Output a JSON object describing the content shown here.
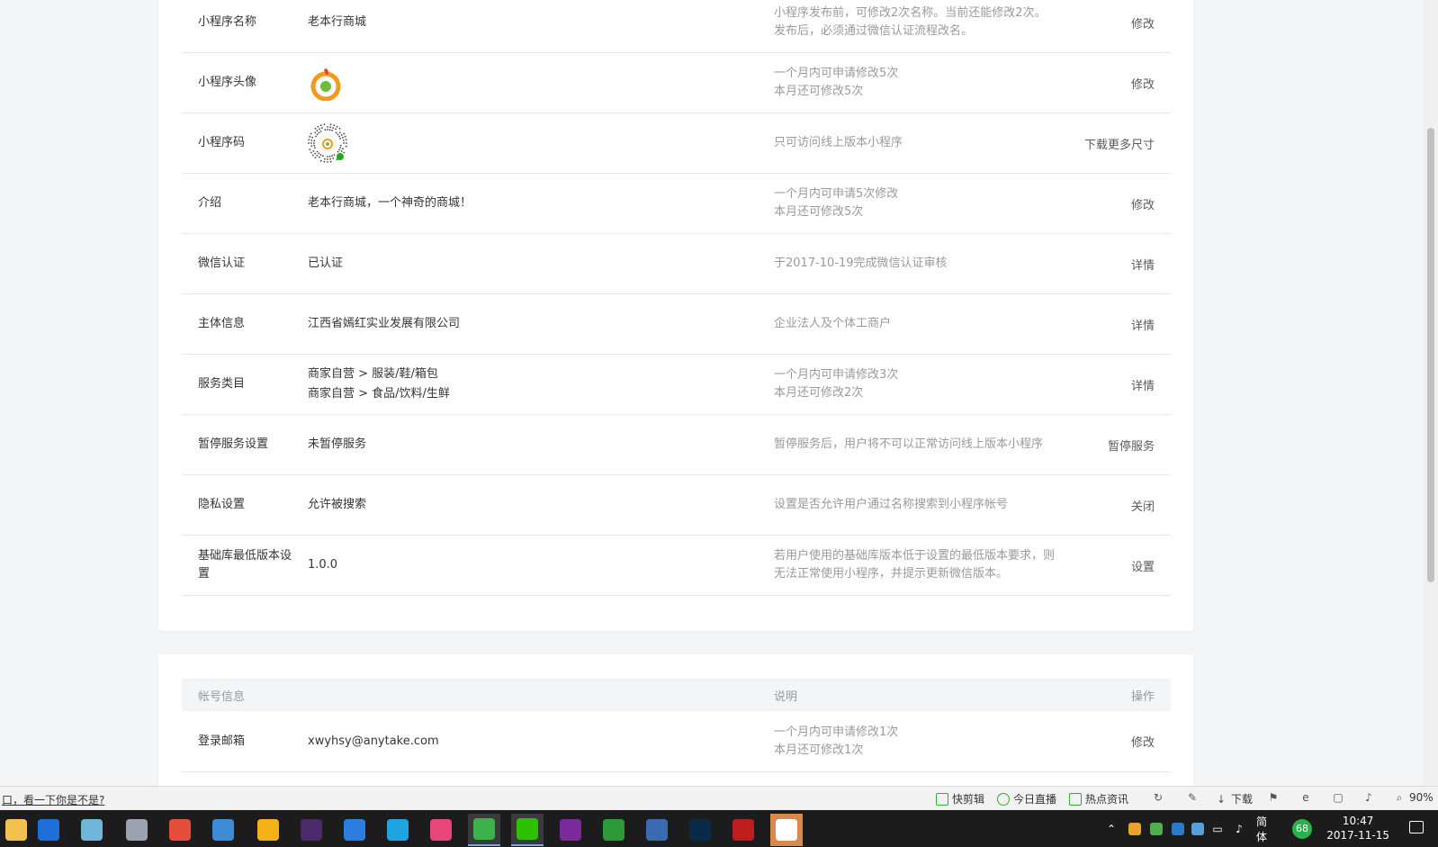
{
  "settings_rows": [
    {
      "label": "小程序名称",
      "value": "老本行商城",
      "desc": [
        "小程序发布前，可修改2次名称。当前还能修改2次。",
        "发布后，必须通过微信认证流程改名。"
      ],
      "action": "修改"
    },
    {
      "label": "小程序头像",
      "value": "",
      "desc": [
        "一个月内可申请修改5次",
        "本月还可修改5次"
      ],
      "action": "修改"
    },
    {
      "label": "小程序码",
      "value": "",
      "desc": [
        "只可访问线上版本小程序"
      ],
      "action": "下载更多尺寸"
    },
    {
      "label": "介绍",
      "value": "老本行商城，一个神奇的商城！",
      "desc": [
        "一个月内可申请5次修改",
        "本月还可修改5次"
      ],
      "action": "修改"
    },
    {
      "label": "微信认证",
      "value": "已认证",
      "desc": [
        "于2017-10-19完成微信认证审核"
      ],
      "action": "详情"
    },
    {
      "label": "主体信息",
      "value": "江西省嫣红实业发展有限公司",
      "desc": [
        "企业法人及个体工商户"
      ],
      "action": "详情"
    },
    {
      "label": "服务类目",
      "value_lines": [
        "商家自营 > 服装/鞋/箱包",
        "商家自营 > 食品/饮料/生鲜"
      ],
      "desc": [
        "一个月内可申请修改3次",
        "本月还可修改2次"
      ],
      "action": "详情"
    },
    {
      "label": "暂停服务设置",
      "value": "未暂停服务",
      "desc": [
        "暂停服务后，用户将不可以正常访问线上版本小程序"
      ],
      "action": "暂停服务"
    },
    {
      "label": "隐私设置",
      "value": "允许被搜索",
      "desc": [
        "设置是否允许用户通过名称搜索到小程序帐号"
      ],
      "action": "关闭"
    },
    {
      "label": "基础库最低版本设置",
      "value": "1.0.0",
      "desc": [
        "若用户使用的基础库版本低于设置的最低版本要求，则",
        "无法正常使用小程序，并提示更新微信版本。"
      ],
      "action": "设置"
    }
  ],
  "account_section": {
    "headers": {
      "name": "帐号信息",
      "desc": "说明",
      "action": "操作"
    },
    "rows": [
      {
        "label": "登录邮箱",
        "value": "xwyhsy@anytake.com",
        "desc": [
          "一个月内可申请修改1次",
          "本月还可修改1次"
        ],
        "action": "修改"
      }
    ]
  },
  "statusbar": {
    "left_text": "口，看一下你是不是?",
    "items": [
      "快剪辑",
      "今日直播",
      "热点资讯",
      "下载"
    ],
    "zoom": "90%"
  },
  "taskbar": {
    "ime": "简体",
    "badge": "68",
    "time": "10:47",
    "date": "2017-11-15",
    "apps": [
      {
        "name": "file-explorer",
        "color": "#f2c14e"
      },
      {
        "name": "edge",
        "color": "#1e6fd9"
      },
      {
        "name": "notes",
        "color": "#6fb7d8"
      },
      {
        "name": "printer",
        "color": "#9aa4b1"
      },
      {
        "name": "chrome",
        "color": "#e44d3a"
      },
      {
        "name": "mail",
        "color": "#3b8bd6"
      },
      {
        "name": "fox",
        "color": "#f3b21a"
      },
      {
        "name": "premiere",
        "color": "#4a2a6a"
      },
      {
        "name": "k-app",
        "color": "#2b7de0"
      },
      {
        "name": "browser",
        "color": "#1fa3e3"
      },
      {
        "name": "color-wheel",
        "color": "#e8457a"
      },
      {
        "name": "green-browser",
        "color": "#3bb24a"
      },
      {
        "name": "wechat",
        "color": "#2dc100"
      },
      {
        "name": "onenote",
        "color": "#7a2a9a"
      },
      {
        "name": "green-app",
        "color": "#2a9a3a"
      },
      {
        "name": "remote",
        "color": "#3a6ab0"
      },
      {
        "name": "photoshop",
        "color": "#0a2a4a"
      },
      {
        "name": "filezilla",
        "color": "#bf1e1e"
      },
      {
        "name": "wechat-devtool",
        "color": "#ffffff"
      }
    ]
  }
}
